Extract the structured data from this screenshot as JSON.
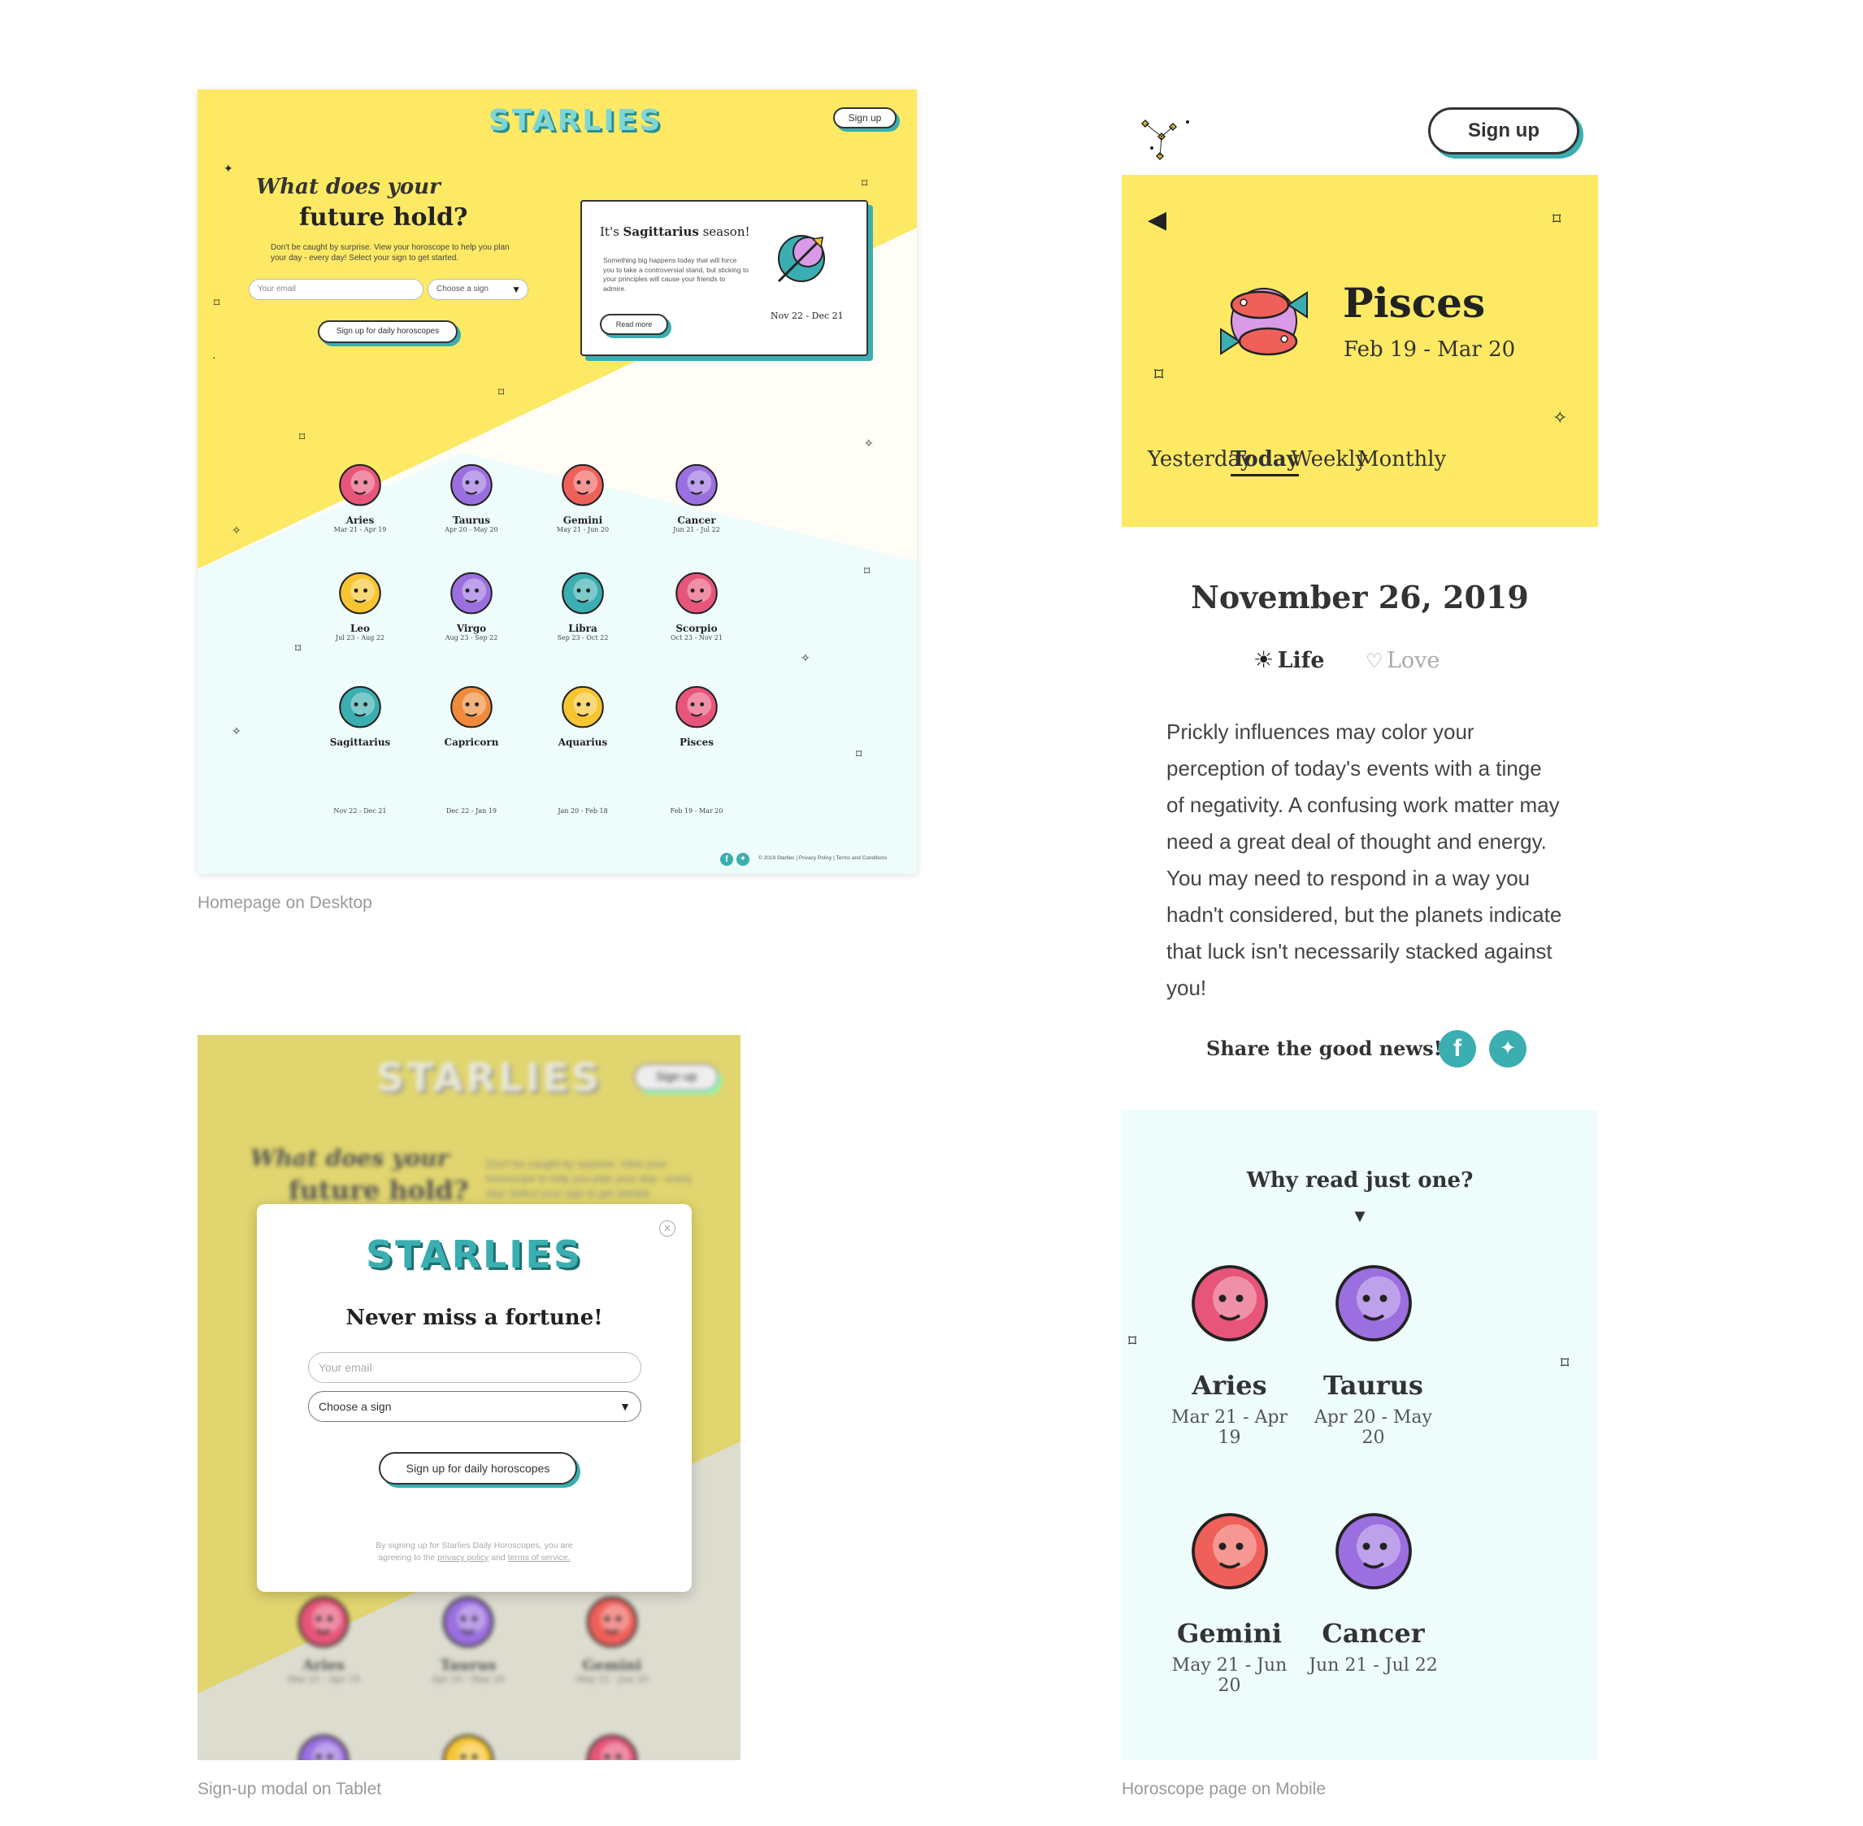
{
  "captions": {
    "desktop": "Homepage on Desktop",
    "tablet": "Sign-up modal on Tablet",
    "mobile": "Horoscope page on Mobile"
  },
  "colors": {
    "yellow": "#fde964",
    "teal": "#3aaeb0",
    "cream": "#fffdf6",
    "mint": "#eefcfc",
    "dark": "#222222"
  },
  "desktop": {
    "logo": "STARLIES",
    "signup": "Sign up",
    "hero_line1": "What does your",
    "hero_line2": "future hold?",
    "hero_body": "Don't be caught by surprise. View your horoscope to help you plan your day - every day! Select your sign to get started.",
    "email_placeholder": "Your email",
    "sign_select": "Choose a sign",
    "cta": "Sign up for daily horoscopes",
    "season_prefix": "It's ",
    "season_sign": "Sagittarius",
    "season_suffix": " season!",
    "season_body": "Something big happens today that will force you to take a controversial stand, but sticking to your principles will cause your friends to admire.",
    "read_more": "Read more",
    "season_dates": "Nov 22 - Dec 21",
    "signs": [
      {
        "name": "Aries",
        "dates": "Mar 21 - Apr 19",
        "icon": "aries-icon",
        "color": "#e8557a"
      },
      {
        "name": "Taurus",
        "dates": "Apr 20 - May 20",
        "icon": "taurus-icon",
        "color": "#9b6fe0"
      },
      {
        "name": "Gemini",
        "dates": "May 21 - Jun 20",
        "icon": "gemini-icon",
        "color": "#f0605a"
      },
      {
        "name": "Cancer",
        "dates": "Jun 21 - Jul 22",
        "icon": "cancer-icon",
        "color": "#9b6fe0"
      },
      {
        "name": "Leo",
        "dates": "Jul 23 - Aug 22",
        "icon": "leo-icon",
        "color": "#f7c531"
      },
      {
        "name": "Virgo",
        "dates": "Aug 23 - Sep 22",
        "icon": "virgo-icon",
        "color": "#9b6fe0"
      },
      {
        "name": "Libra",
        "dates": "Sep 23 - Oct 22",
        "icon": "libra-icon",
        "color": "#3aaeb0"
      },
      {
        "name": "Scorpio",
        "dates": "Oct 23 - Nov 21",
        "icon": "scorpio-icon",
        "color": "#e8557a"
      },
      {
        "name": "Sagittarius",
        "dates": "Nov 22 - Dec 21",
        "icon": "sagittarius-icon",
        "color": "#3aaeb0"
      },
      {
        "name": "Capricorn",
        "dates": "Dec 22 - Jan 19",
        "icon": "capricorn-icon",
        "color": "#f08a3a"
      },
      {
        "name": "Aquarius",
        "dates": "Jan 20 - Feb 18",
        "icon": "aquarius-icon",
        "color": "#f7c531"
      },
      {
        "name": "Pisces",
        "dates": "Feb 19 - Mar 20",
        "icon": "pisces-icon",
        "color": "#e8557a"
      }
    ],
    "footer": "© 2019 Starlies  |  Privacy Policy  |  Terms and Conditions"
  },
  "tablet": {
    "logo": "STARLIES",
    "signup": "Sign up",
    "hero_line1": "What does your",
    "hero_line2": "future hold?",
    "hero_body": "Don't be caught by surprise. View your horoscope to help you plan your day - every day! Select your sign to get started.",
    "modal": {
      "logo": "STARLIES",
      "title": "Never miss a fortune!",
      "email_placeholder": "Your email",
      "sign_select": "Choose a sign",
      "cta": "Sign up for daily horoscopes",
      "legal_1": "By signing up for Starlies Daily Horoscopes, you are",
      "legal_2": "agreeing to the ",
      "privacy": "privacy policy",
      "and": " and ",
      "terms": "terms of service."
    },
    "bg_signs": [
      {
        "name": "Aries",
        "dates": "Mar 21 - Apr 19"
      },
      {
        "name": "Taurus",
        "dates": "Apr 20 - May 20"
      },
      {
        "name": "Gemini",
        "dates": "May 21 - Jun 20"
      }
    ]
  },
  "mobile": {
    "signup": "Sign up",
    "sign_name": "Pisces",
    "sign_dates": "Feb 19 - Mar 20",
    "tabs": [
      "Yesterday",
      "Today",
      "Weekly",
      "Monthly"
    ],
    "active_tab": "Today",
    "date": "November 26, 2019",
    "life": "Life",
    "love": "Love",
    "reading": "Prickly influences may color your perception of today's events with a tinge of negativity. A confusing work matter may need a great deal of thought and energy. You may need to respond in a way you hadn't considered, but the planets indicate that luck isn't necessarily stacked against you!",
    "share": "Share the good news!",
    "why": "Why read just one?",
    "more_signs": [
      {
        "name": "Aries",
        "dates": "Mar 21 - Apr 19"
      },
      {
        "name": "Taurus",
        "dates": "Apr 20 - May 20"
      },
      {
        "name": "Gemini",
        "dates": "May 21 - Jun 20"
      },
      {
        "name": "Cancer",
        "dates": "Jun 21 - Jul 22"
      }
    ]
  }
}
